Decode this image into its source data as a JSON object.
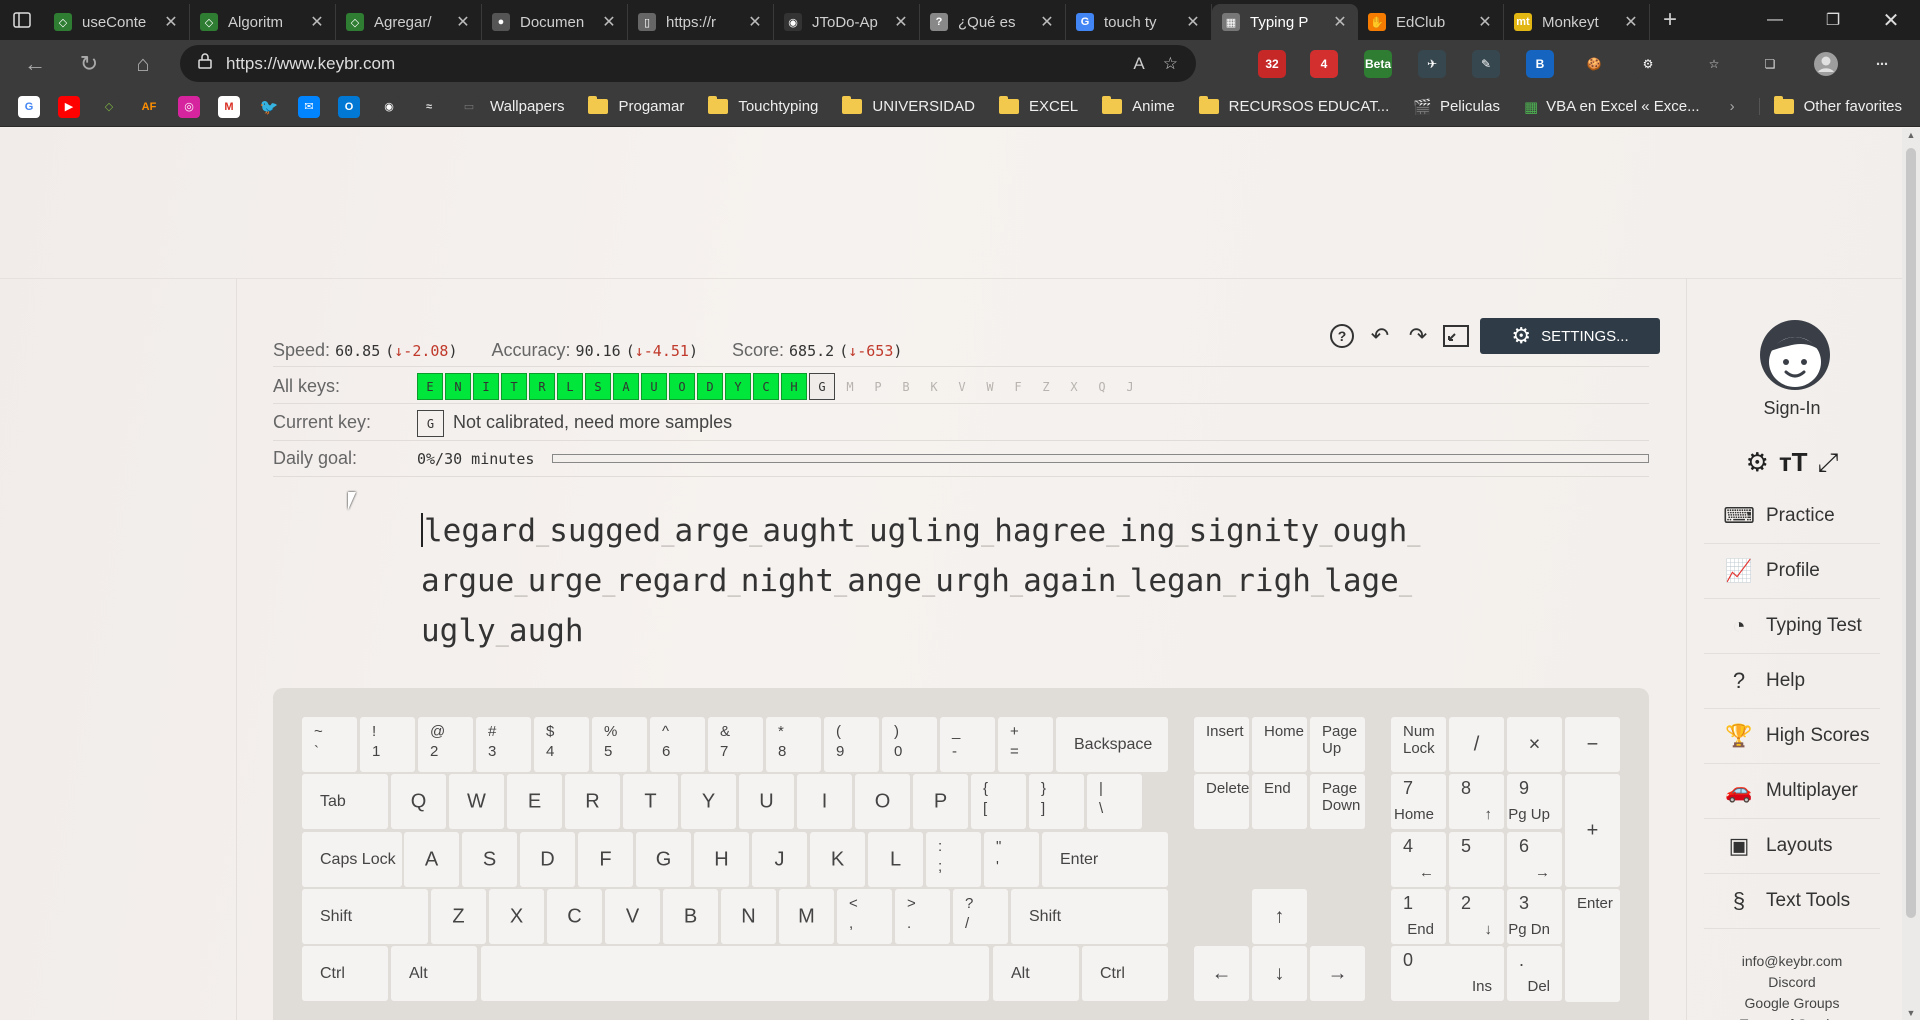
{
  "browser": {
    "tabs": [
      {
        "title": "useConte",
        "fav": "#2e7d32",
        "glyph": "◇"
      },
      {
        "title": "Algoritm",
        "fav": "#2e7d32",
        "glyph": "◇"
      },
      {
        "title": "Agregar/",
        "fav": "#2e7d32",
        "glyph": "◇"
      },
      {
        "title": "Documen",
        "fav": "#555555",
        "glyph": "●"
      },
      {
        "title": "https://r",
        "fav": "#666666",
        "glyph": "▯"
      },
      {
        "title": "JToDo-Ap",
        "fav": "#333333",
        "glyph": "◉"
      },
      {
        "title": "¿Qué es",
        "fav": "#888888",
        "glyph": "?"
      },
      {
        "title": "touch ty",
        "fav": "#4285f4",
        "glyph": "G"
      },
      {
        "title": "Typing P",
        "fav": "#777777",
        "glyph": "▦",
        "active": true
      },
      {
        "title": "EdClub",
        "fav": "#f57c00",
        "glyph": "✋"
      },
      {
        "title": "Monkeyt",
        "fav": "#e2b714",
        "glyph": "mt"
      }
    ],
    "url": "https://www.keybr.com",
    "extensions": [
      {
        "label": "32",
        "color": "#c62828"
      },
      {
        "label": "4",
        "color": "#d32f2f"
      },
      {
        "label": "Beta",
        "color": "#2e7d32"
      },
      {
        "label": "✈",
        "color": "#37474f"
      },
      {
        "label": "✎",
        "color": "#37474f"
      },
      {
        "label": "B",
        "color": "#1565c0"
      },
      {
        "label": "🍪",
        "color": "#3b3b3b"
      },
      {
        "label": "⚙",
        "color": "#3b3b3b"
      }
    ],
    "bookmarks": [
      "Wallpapers",
      "Progamar",
      "Touchtyping",
      "UNIVERSIDAD",
      "EXCEL",
      "Anime",
      "RECURSOS EDUCAT...",
      "Peliculas",
      "VBA en Excel « Exce..."
    ],
    "other_favorites": "Other favorites"
  },
  "stats": {
    "speed_label": "Speed:",
    "speed_val": "60.85",
    "speed_delta": "↓-2.08",
    "acc_label": "Accuracy:",
    "acc_val": "90.16",
    "acc_delta": "↓-4.51",
    "score_label": "Score:",
    "score_val": "685.2",
    "score_delta": "↓-653"
  },
  "settings_label": "SETTINGS...",
  "all_keys_label": "All keys:",
  "keys_done": [
    "E",
    "N",
    "I",
    "T",
    "R",
    "L",
    "S",
    "A",
    "U",
    "O",
    "D",
    "Y",
    "C",
    "H"
  ],
  "key_current": "G",
  "keys_pending": [
    "M",
    "P",
    "B",
    "K",
    "V",
    "W",
    "F",
    "Z",
    "X",
    "Q",
    "J"
  ],
  "current_key_label": "Current key:",
  "current_key": "G",
  "current_key_note": "Not calibrated, need more samples",
  "daily_goal_label": "Daily goal:",
  "daily_goal_text": "0%/30 minutes",
  "daily_goal_progress": 0,
  "lesson_words": [
    "legard",
    "sugged",
    "arge",
    "aught",
    "ugling",
    "hagree",
    "ing",
    "signity",
    "ough",
    "argue",
    "urge",
    "regard",
    "night",
    "ange",
    "urgh",
    "again",
    "legan",
    "righ",
    "lage",
    "ugly",
    "augh"
  ],
  "keyboard": {
    "row1": [
      [
        "~",
        "`"
      ],
      [
        "!",
        "1"
      ],
      [
        "@",
        "2"
      ],
      [
        "#",
        "3"
      ],
      [
        "$",
        "4"
      ],
      [
        "%",
        "5"
      ],
      [
        "^",
        "6"
      ],
      [
        "&",
        "7"
      ],
      [
        "*",
        "8"
      ],
      [
        "(",
        "9"
      ],
      [
        ")",
        "0"
      ],
      [
        "_",
        "-"
      ],
      [
        "+",
        "="
      ]
    ],
    "backspace": "Backspace",
    "tab": "Tab",
    "row2": [
      "Q",
      "W",
      "E",
      "R",
      "T",
      "Y",
      "U",
      "I",
      "O",
      "P"
    ],
    "row2_sym": [
      [
        "{",
        "["
      ],
      [
        "}",
        "]"
      ],
      [
        "|",
        "\\"
      ]
    ],
    "caps": "Caps Lock",
    "row3": [
      "A",
      "S",
      "D",
      "F",
      "G",
      "H",
      "J",
      "K",
      "L"
    ],
    "row3_sym": [
      [
        ":",
        ";"
      ],
      [
        "\"",
        "'"
      ]
    ],
    "enter": "Enter",
    "shift": "Shift",
    "row4": [
      "Z",
      "X",
      "C",
      "V",
      "B",
      "N",
      "M"
    ],
    "row4_sym": [
      [
        "<",
        ","
      ],
      [
        ">",
        "."
      ],
      [
        "?",
        "/"
      ]
    ],
    "ctrl": "Ctrl",
    "alt": "Alt",
    "nav": [
      "Insert",
      "Home",
      "Page\nUp",
      "Delete",
      "End",
      "Page\nDown"
    ],
    "arrows": {
      "up": "↑",
      "left": "←",
      "down": "↓",
      "right": "→"
    },
    "numlock": "Num\nLock",
    "num_div": "/",
    "num_mul": "×",
    "num_sub": "−",
    "num_add": "+",
    "num_enter": "Enter",
    "num": [
      [
        "7",
        "Home"
      ],
      [
        "8",
        "↑"
      ],
      [
        "9",
        "Pg Up"
      ],
      [
        "4",
        "←"
      ],
      [
        "5",
        ""
      ],
      [
        "6",
        "→"
      ],
      [
        "1",
        "End"
      ],
      [
        "2",
        "↓"
      ],
      [
        "3",
        "Pg Dn"
      ],
      [
        "0",
        "Ins"
      ],
      [
        ".",
        "Del"
      ]
    ]
  },
  "nav": {
    "signin": "Sign-In",
    "items": [
      {
        "label": "Practice",
        "icon": "⌨"
      },
      {
        "label": "Profile",
        "icon": "📈"
      },
      {
        "label": "Typing Test",
        "icon": "◔"
      },
      {
        "label": "Help",
        "icon": "?"
      },
      {
        "label": "High Scores",
        "icon": "🏆"
      },
      {
        "label": "Multiplayer",
        "icon": "🚗"
      },
      {
        "label": "Layouts",
        "icon": "▣"
      },
      {
        "label": "Text Tools",
        "icon": "§"
      }
    ],
    "footer": [
      "info@keybr.com",
      "Discord",
      "Google Groups",
      "Terms of Service"
    ]
  }
}
